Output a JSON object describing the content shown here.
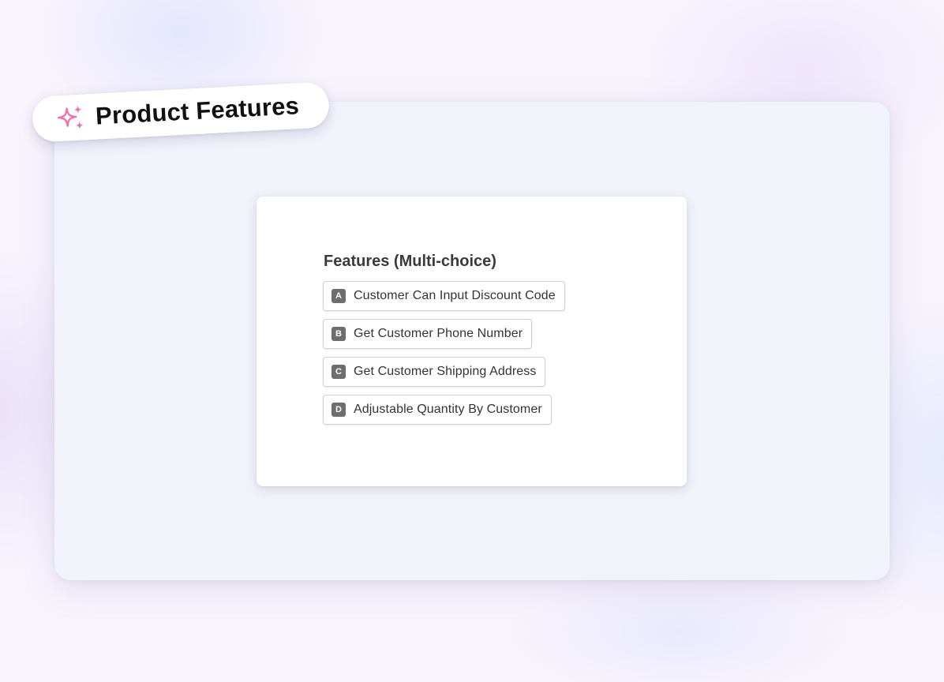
{
  "header": {
    "title": "Product Features",
    "icon": "sparkles-icon",
    "icon_color": "#f06fb3"
  },
  "question": {
    "title": "Features (Multi-choice)",
    "options": [
      {
        "key": "A",
        "label": "Customer Can Input Discount Code"
      },
      {
        "key": "B",
        "label": "Get Customer Phone Number"
      },
      {
        "key": "C",
        "label": "Get Customer Shipping Address"
      },
      {
        "key": "D",
        "label": "Adjustable Quantity By Customer"
      }
    ]
  }
}
